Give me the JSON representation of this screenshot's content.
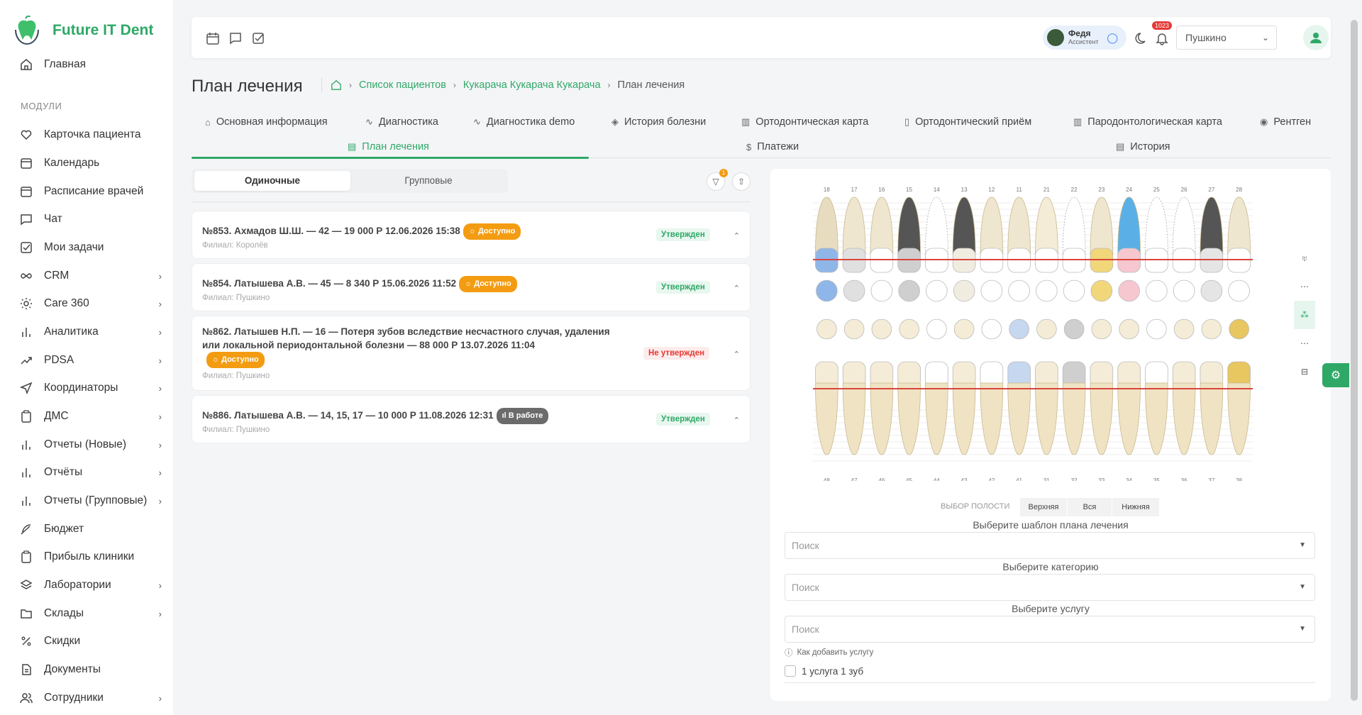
{
  "app": {
    "name": "Future IT Dent"
  },
  "sidebar": {
    "home": "Главная",
    "section": "МОДУЛИ",
    "items": [
      {
        "label": "Карточка пациента",
        "icon": "heart-icon",
        "chevron": false
      },
      {
        "label": "Календарь",
        "icon": "calendar-icon",
        "chevron": false
      },
      {
        "label": "Расписание врачей",
        "icon": "calendar-icon",
        "chevron": false
      },
      {
        "label": "Чат",
        "icon": "chat-icon",
        "chevron": false
      },
      {
        "label": "Мои задачи",
        "icon": "checkbox-icon",
        "chevron": false
      },
      {
        "label": "CRM",
        "icon": "infinity-icon",
        "chevron": true
      },
      {
        "label": "Care 360",
        "icon": "sun-icon",
        "chevron": true
      },
      {
        "label": "Аналитика",
        "icon": "bar-chart-icon",
        "chevron": true
      },
      {
        "label": "PDSA",
        "icon": "trend-icon",
        "chevron": true
      },
      {
        "label": "Координаторы",
        "icon": "send-icon",
        "chevron": true
      },
      {
        "label": "ДМС",
        "icon": "clipboard-icon",
        "chevron": true
      },
      {
        "label": "Отчеты (Новые)",
        "icon": "bar-chart-icon",
        "chevron": true
      },
      {
        "label": "Отчёты",
        "icon": "bar-chart-icon",
        "chevron": true
      },
      {
        "label": "Отчеты (Групповые)",
        "icon": "bar-chart-icon",
        "chevron": true
      },
      {
        "label": "Бюджет",
        "icon": "feather-icon",
        "chevron": false
      },
      {
        "label": "Прибыль клиники",
        "icon": "clipboard-icon",
        "chevron": false
      },
      {
        "label": "Лаборатории",
        "icon": "layers-icon",
        "chevron": true
      },
      {
        "label": "Склады",
        "icon": "folder-icon",
        "chevron": true
      },
      {
        "label": "Скидки",
        "icon": "percent-icon",
        "chevron": false
      },
      {
        "label": "Документы",
        "icon": "document-icon",
        "chevron": false
      },
      {
        "label": "Сотрудники",
        "icon": "users-icon",
        "chevron": true
      }
    ]
  },
  "header": {
    "assistant_name": "Федя",
    "assistant_role": "Ассистент",
    "notifications_count": "1023",
    "branch": "Пушкино"
  },
  "page": {
    "title": "План лечения",
    "breadcrumb": [
      "Список пациентов",
      "Кукарача Кукарача Кукарача",
      "План лечения"
    ]
  },
  "tabs": [
    {
      "label": "Основная информация",
      "icon": "home-icon"
    },
    {
      "label": "Диагностика",
      "icon": "pulse-icon"
    },
    {
      "label": "Диагностика demo",
      "icon": "pulse-icon"
    },
    {
      "label": "История болезни",
      "icon": "tag-icon"
    },
    {
      "label": "Ортодонтическая карта",
      "icon": "map-icon"
    },
    {
      "label": "Ортодонтический приём",
      "icon": "clipboard-icon"
    },
    {
      "label": "Пародонтологическая карта",
      "icon": "map-icon"
    },
    {
      "label": "Рентген",
      "icon": "radio-icon"
    },
    {
      "label": "План лечения",
      "icon": "document-icon"
    },
    {
      "label": "Платежи",
      "icon": "dollar-icon"
    },
    {
      "label": "История",
      "icon": "document-icon"
    }
  ],
  "plans": {
    "segments": [
      "Одиночные",
      "Групповые"
    ],
    "filter_count": "1",
    "items": [
      {
        "title": "№853. Ахмадов Ш.Ш. — 42 — 19 000 Р 12.06.2026 15:38",
        "badge": "Доступно",
        "branch": "Филиал: Королёв",
        "status": "Утвержден"
      },
      {
        "title": "№854. Латышева А.В. — 45 — 8 340 Р 15.06.2026 11:52",
        "badge": "Доступно",
        "branch": "Филиал: Пушкино",
        "status": "Утвержден"
      },
      {
        "title": "№862. Латышев Н.П. — 16 — Потеря зубов вследствие несчастного случая, удаления или локальной периодонтальной болезни — 88 000 Р 13.07.2026 11:04",
        "badge": "Доступно",
        "branch": "Филиал: Пушкино",
        "status": "Не утвержден"
      },
      {
        "title": "№886. Латышева А.В. — 14, 15, 17 — 10 000 Р 11.08.2026 12:31",
        "badge": "В работе",
        "branch": "Филиал: Пушкино",
        "status": "Утвержден"
      }
    ]
  },
  "dental_chart": {
    "upper_numbers": [
      "18",
      "17",
      "16",
      "15",
      "14",
      "13",
      "12",
      "11",
      "21",
      "22",
      "23",
      "24",
      "25",
      "26",
      "27",
      "28"
    ],
    "lower_numbers": [
      "48",
      "47",
      "46",
      "45",
      "44",
      "43",
      "42",
      "41",
      "31",
      "32",
      "33",
      "34",
      "35",
      "36",
      "37",
      "38"
    ],
    "jaw_label": "ВЫБОР ПОЛОСТИ",
    "jaw_options": [
      "Верхняя",
      "Вся",
      "Нижняя"
    ]
  },
  "form": {
    "template_label": "Выберите шаблон плана лечения",
    "category_label": "Выберите категорию",
    "service_label": "Выберите услугу",
    "placeholder": "Поиск",
    "hint": "Как добавить услугу",
    "checkbox": "1 услуга 1 зуб"
  }
}
